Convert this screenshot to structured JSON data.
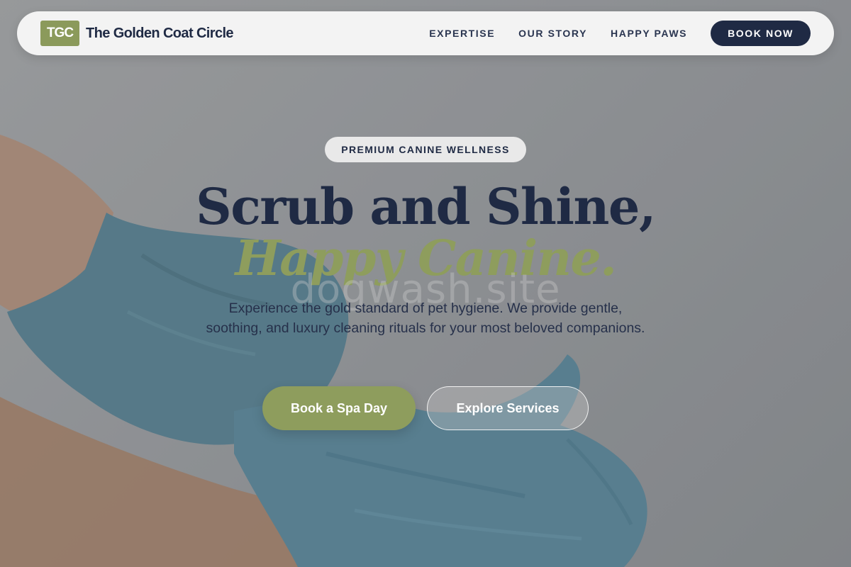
{
  "brand": {
    "logo_text": "TGC",
    "name": "The Golden Coat Circle"
  },
  "nav": {
    "links": [
      "EXPERTISE",
      "OUR STORY",
      "HAPPY PAWS"
    ],
    "cta_label": "BOOK NOW"
  },
  "hero": {
    "badge": "PREMIUM CANINE WELLNESS",
    "headline": "Scrub and Shine,",
    "headline_accent": "Happy Canine.",
    "watermark": "dogwash.site",
    "subtext": "Experience the gold standard of pet hygiene. We provide gentle, soothing, and luxury cleaning rituals for your most beloved companions.",
    "primary_button": "Book a Spa Day",
    "secondary_button": "Explore Services"
  },
  "colors": {
    "navy": "#1f2a44",
    "olive": "#8e9d5d",
    "nav_bg": "#f3f3f3",
    "glove_blue": "#4d7a8e"
  }
}
